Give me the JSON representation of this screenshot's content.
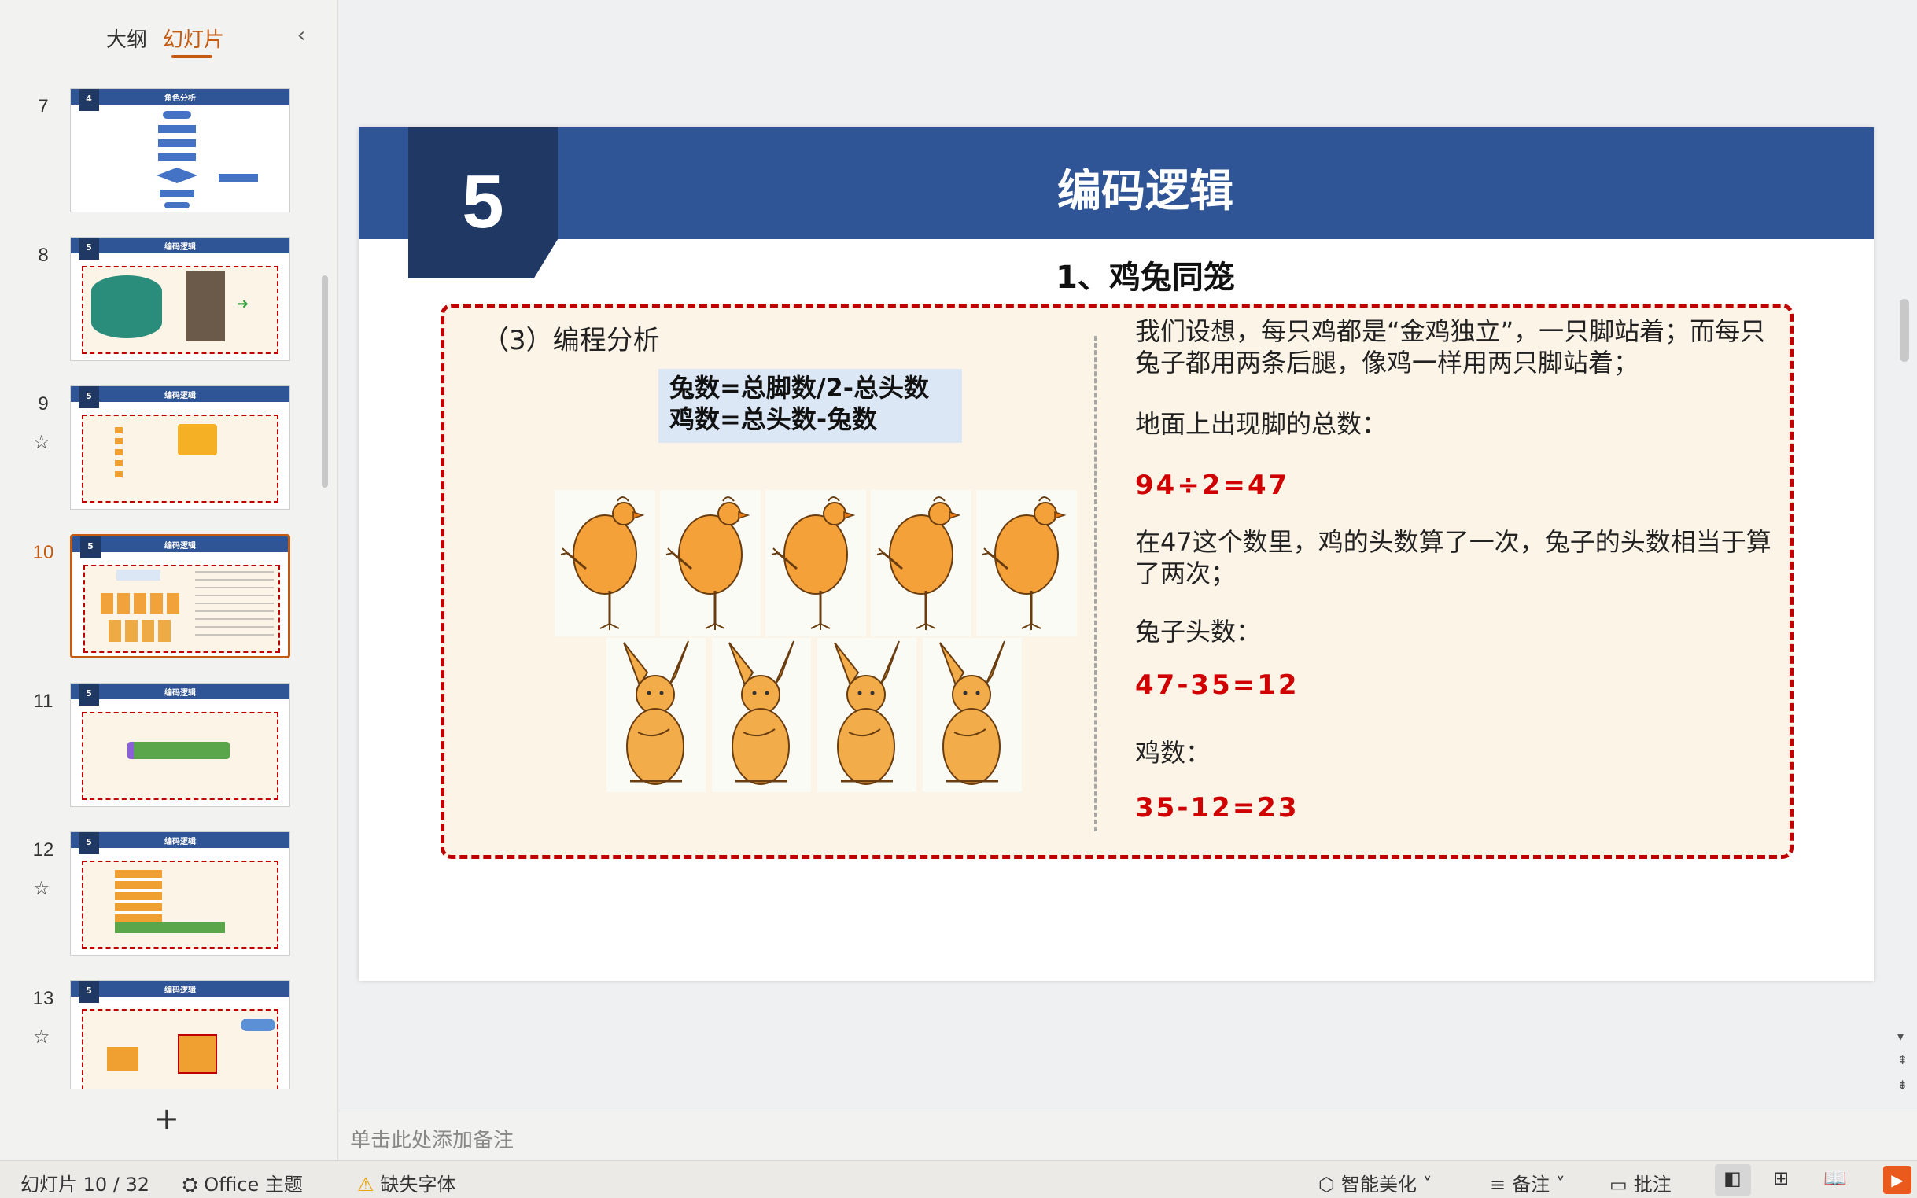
{
  "left_panel": {
    "tabs": [
      {
        "label": "大纲"
      },
      {
        "label": "幻灯片"
      }
    ],
    "collapse_icon": "chevron-left-icon",
    "add_slide_label": "+"
  },
  "thumbnails": [
    {
      "number": "7",
      "badge": "4",
      "title": "角色分析",
      "starred": false,
      "active": false
    },
    {
      "number": "8",
      "badge": "5",
      "title": "编码逻辑",
      "starred": false,
      "active": false
    },
    {
      "number": "9",
      "badge": "5",
      "title": "编码逻辑",
      "starred": true,
      "active": false
    },
    {
      "number": "10",
      "badge": "5",
      "title": "编码逻辑",
      "starred": false,
      "active": true
    },
    {
      "number": "11",
      "badge": "5",
      "title": "编码逻辑",
      "starred": false,
      "active": false
    },
    {
      "number": "12",
      "badge": "5",
      "title": "编码逻辑",
      "starred": true,
      "active": false
    },
    {
      "number": "13",
      "badge": "5",
      "title": "编码逻辑",
      "starred": true,
      "active": false
    }
  ],
  "slide": {
    "number": "5",
    "title": "编码逻辑",
    "subtitle": "1、鸡兔同笼",
    "section_heading": "（3）编程分析",
    "formula_line1": "兔数=总脚数/2-总头数",
    "formula_line2": "鸡数=总头数-兔数",
    "right_text": {
      "p1": "我们设想，每只鸡都是“金鸡独立”，一只脚站着；而每只兔子都用两条后腿，像鸡一样用两只脚站着；",
      "p2": "地面上出现脚的总数：",
      "eq1": "94÷2=47",
      "p3": "在47这个数里，鸡的头数算了一次，兔子的头数相当于算了两次；",
      "p4": "兔子头数：",
      "eq2": "47-35=12",
      "p5": "鸡数：",
      "eq3": "35-12=23"
    }
  },
  "notes": {
    "placeholder": "单击此处添加备注"
  },
  "status_bar": {
    "slide_counter": "幻灯片 10 / 32",
    "theme": "Office 主题",
    "missing_font": "缺失字体",
    "smart_beautify": "智能美化",
    "notes": "备注",
    "comments": "批注"
  },
  "colors": {
    "header_blue": "#2f5597",
    "header_dark": "#1f3864",
    "accent_orange": "#c55a11",
    "dash_red": "#c00000",
    "equation_red": "#d00000"
  }
}
